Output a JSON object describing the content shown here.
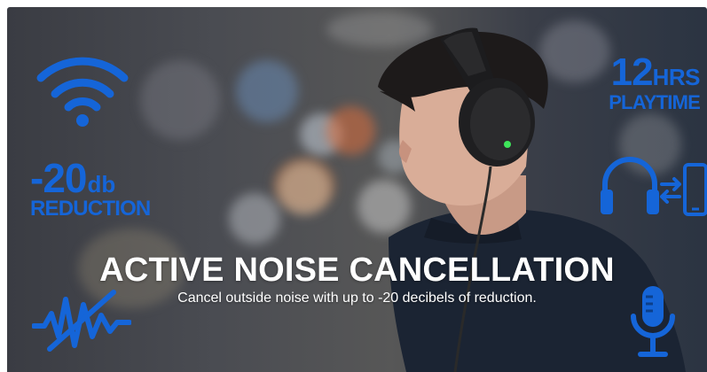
{
  "banner": {
    "headline": "ACTIVE NOISE CANCELLATION",
    "subheadline": "Cancel outside noise with up to -20 decibels of reduction."
  },
  "features": {
    "noise_reduction": {
      "value": "-20",
      "unit": "db",
      "caption": "REDUCTION",
      "icon": "wifi-icon"
    },
    "playtime": {
      "value": "12",
      "unit": "HRS",
      "caption": "PLAYTIME",
      "icon": "headphone-phone-icon"
    },
    "extra_icons": [
      "waveform-icon",
      "microphone-icon"
    ]
  },
  "colors": {
    "accent": "#1565d8",
    "text": "#ffffff"
  }
}
